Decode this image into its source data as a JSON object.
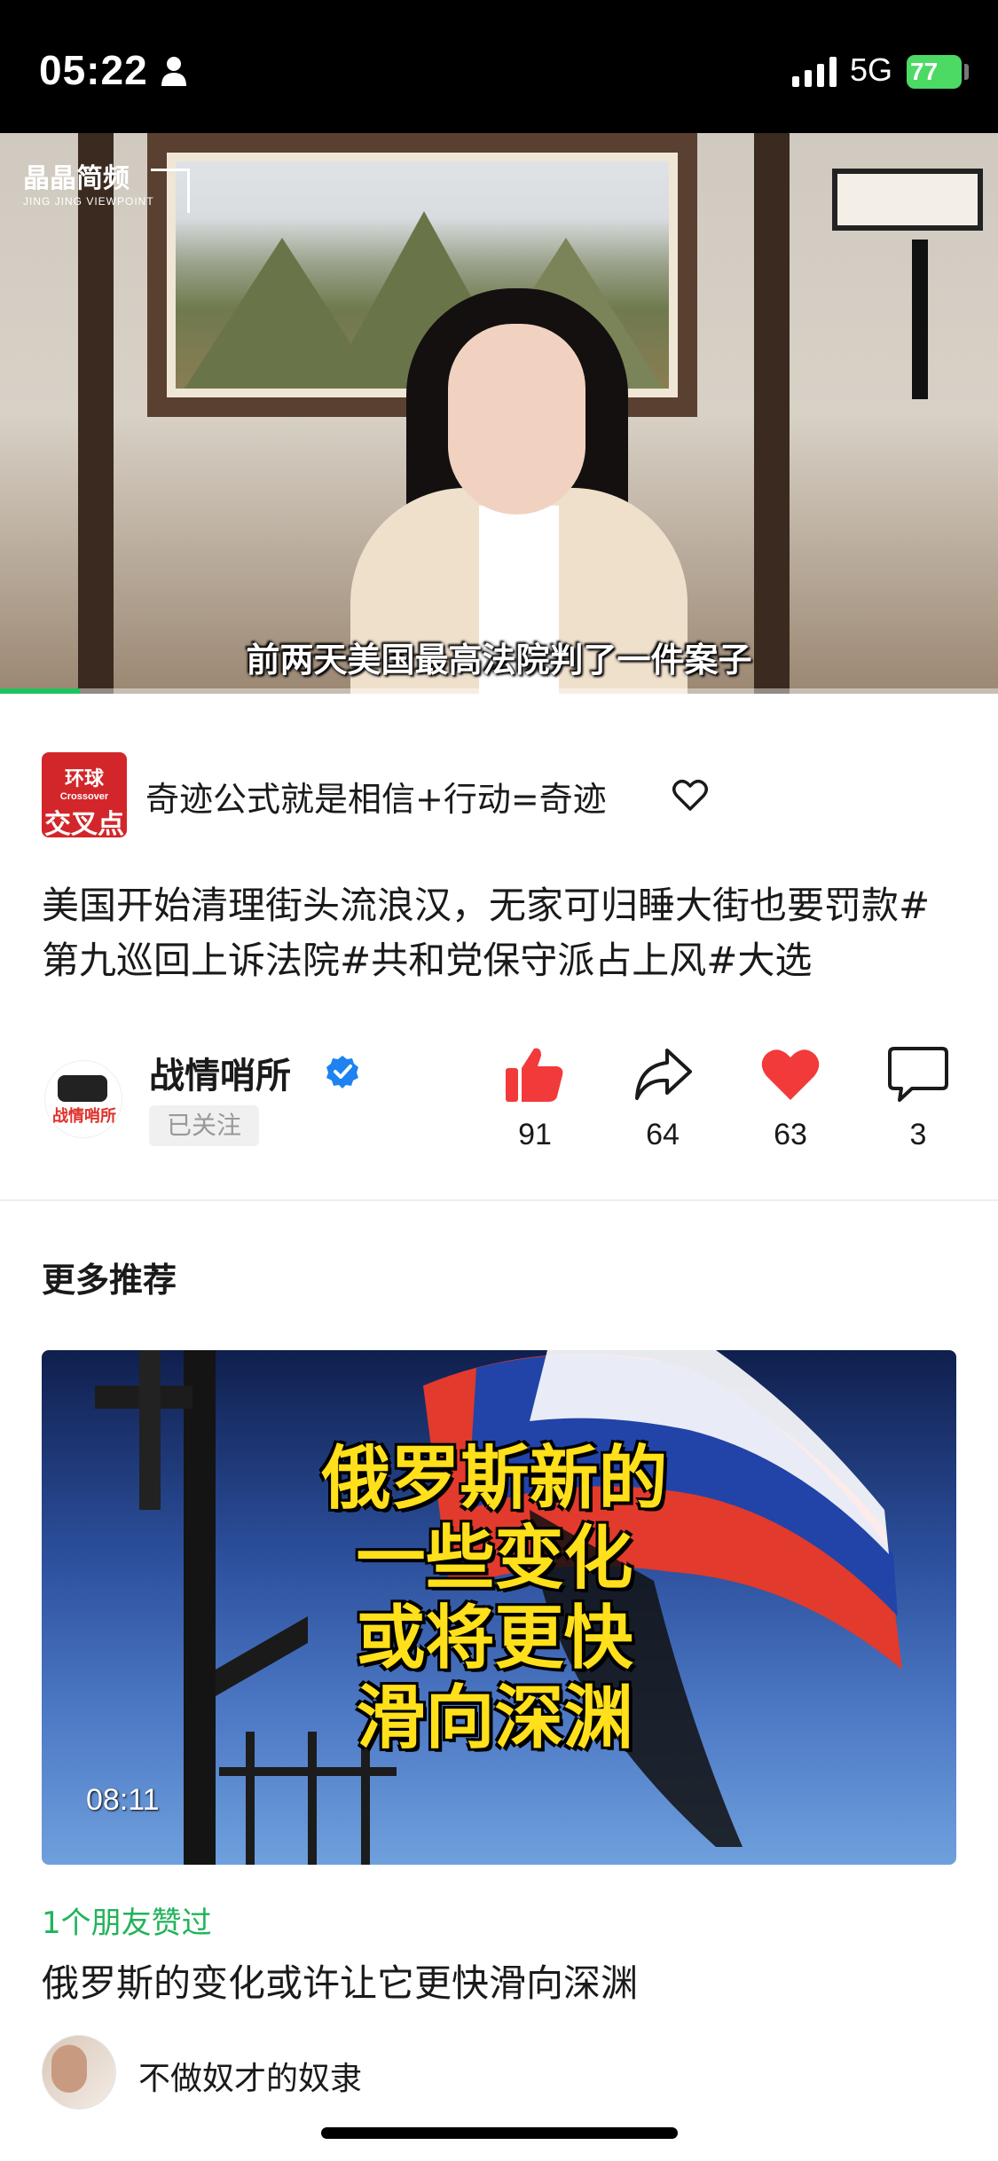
{
  "status_bar": {
    "time": "05:22",
    "network": "5G",
    "battery": "77"
  },
  "video": {
    "channel_logo": "晶晶简频",
    "channel_logo_sub": "JING JING VIEWPOINT",
    "subtitle": "前两天美国最高法院判了一件案子",
    "progress": 0.08,
    "progress_color": "#21c25e"
  },
  "account": {
    "avatar_text_top": "环球",
    "avatar_text_sub": "Crossover",
    "avatar_text_bottom": "交叉点",
    "name": "奇迹公式就是相信+行动=奇迹"
  },
  "description": "美国开始清理街头流浪汉，无家可归睡大街也要罚款#第九巡回上诉法院#共和党保守派占上风#大选",
  "author": {
    "name": "战情哨所",
    "avatar_text": "战情哨所",
    "follow_label": "已关注"
  },
  "actions": {
    "like_count": "91",
    "share_count": "64",
    "favorite_count": "63",
    "comment_count": "3",
    "like_color": "#f23a3a"
  },
  "recommended": {
    "section_title": "更多推荐",
    "thumb_text": [
      "俄罗斯新的",
      "一些变化",
      "或将更快",
      "滑向深渊"
    ],
    "duration": "08:11",
    "friend_like": "1个朋友赞过",
    "title": "俄罗斯的变化或许让它更快滑向深渊",
    "author": "不做奴才的奴隶"
  }
}
